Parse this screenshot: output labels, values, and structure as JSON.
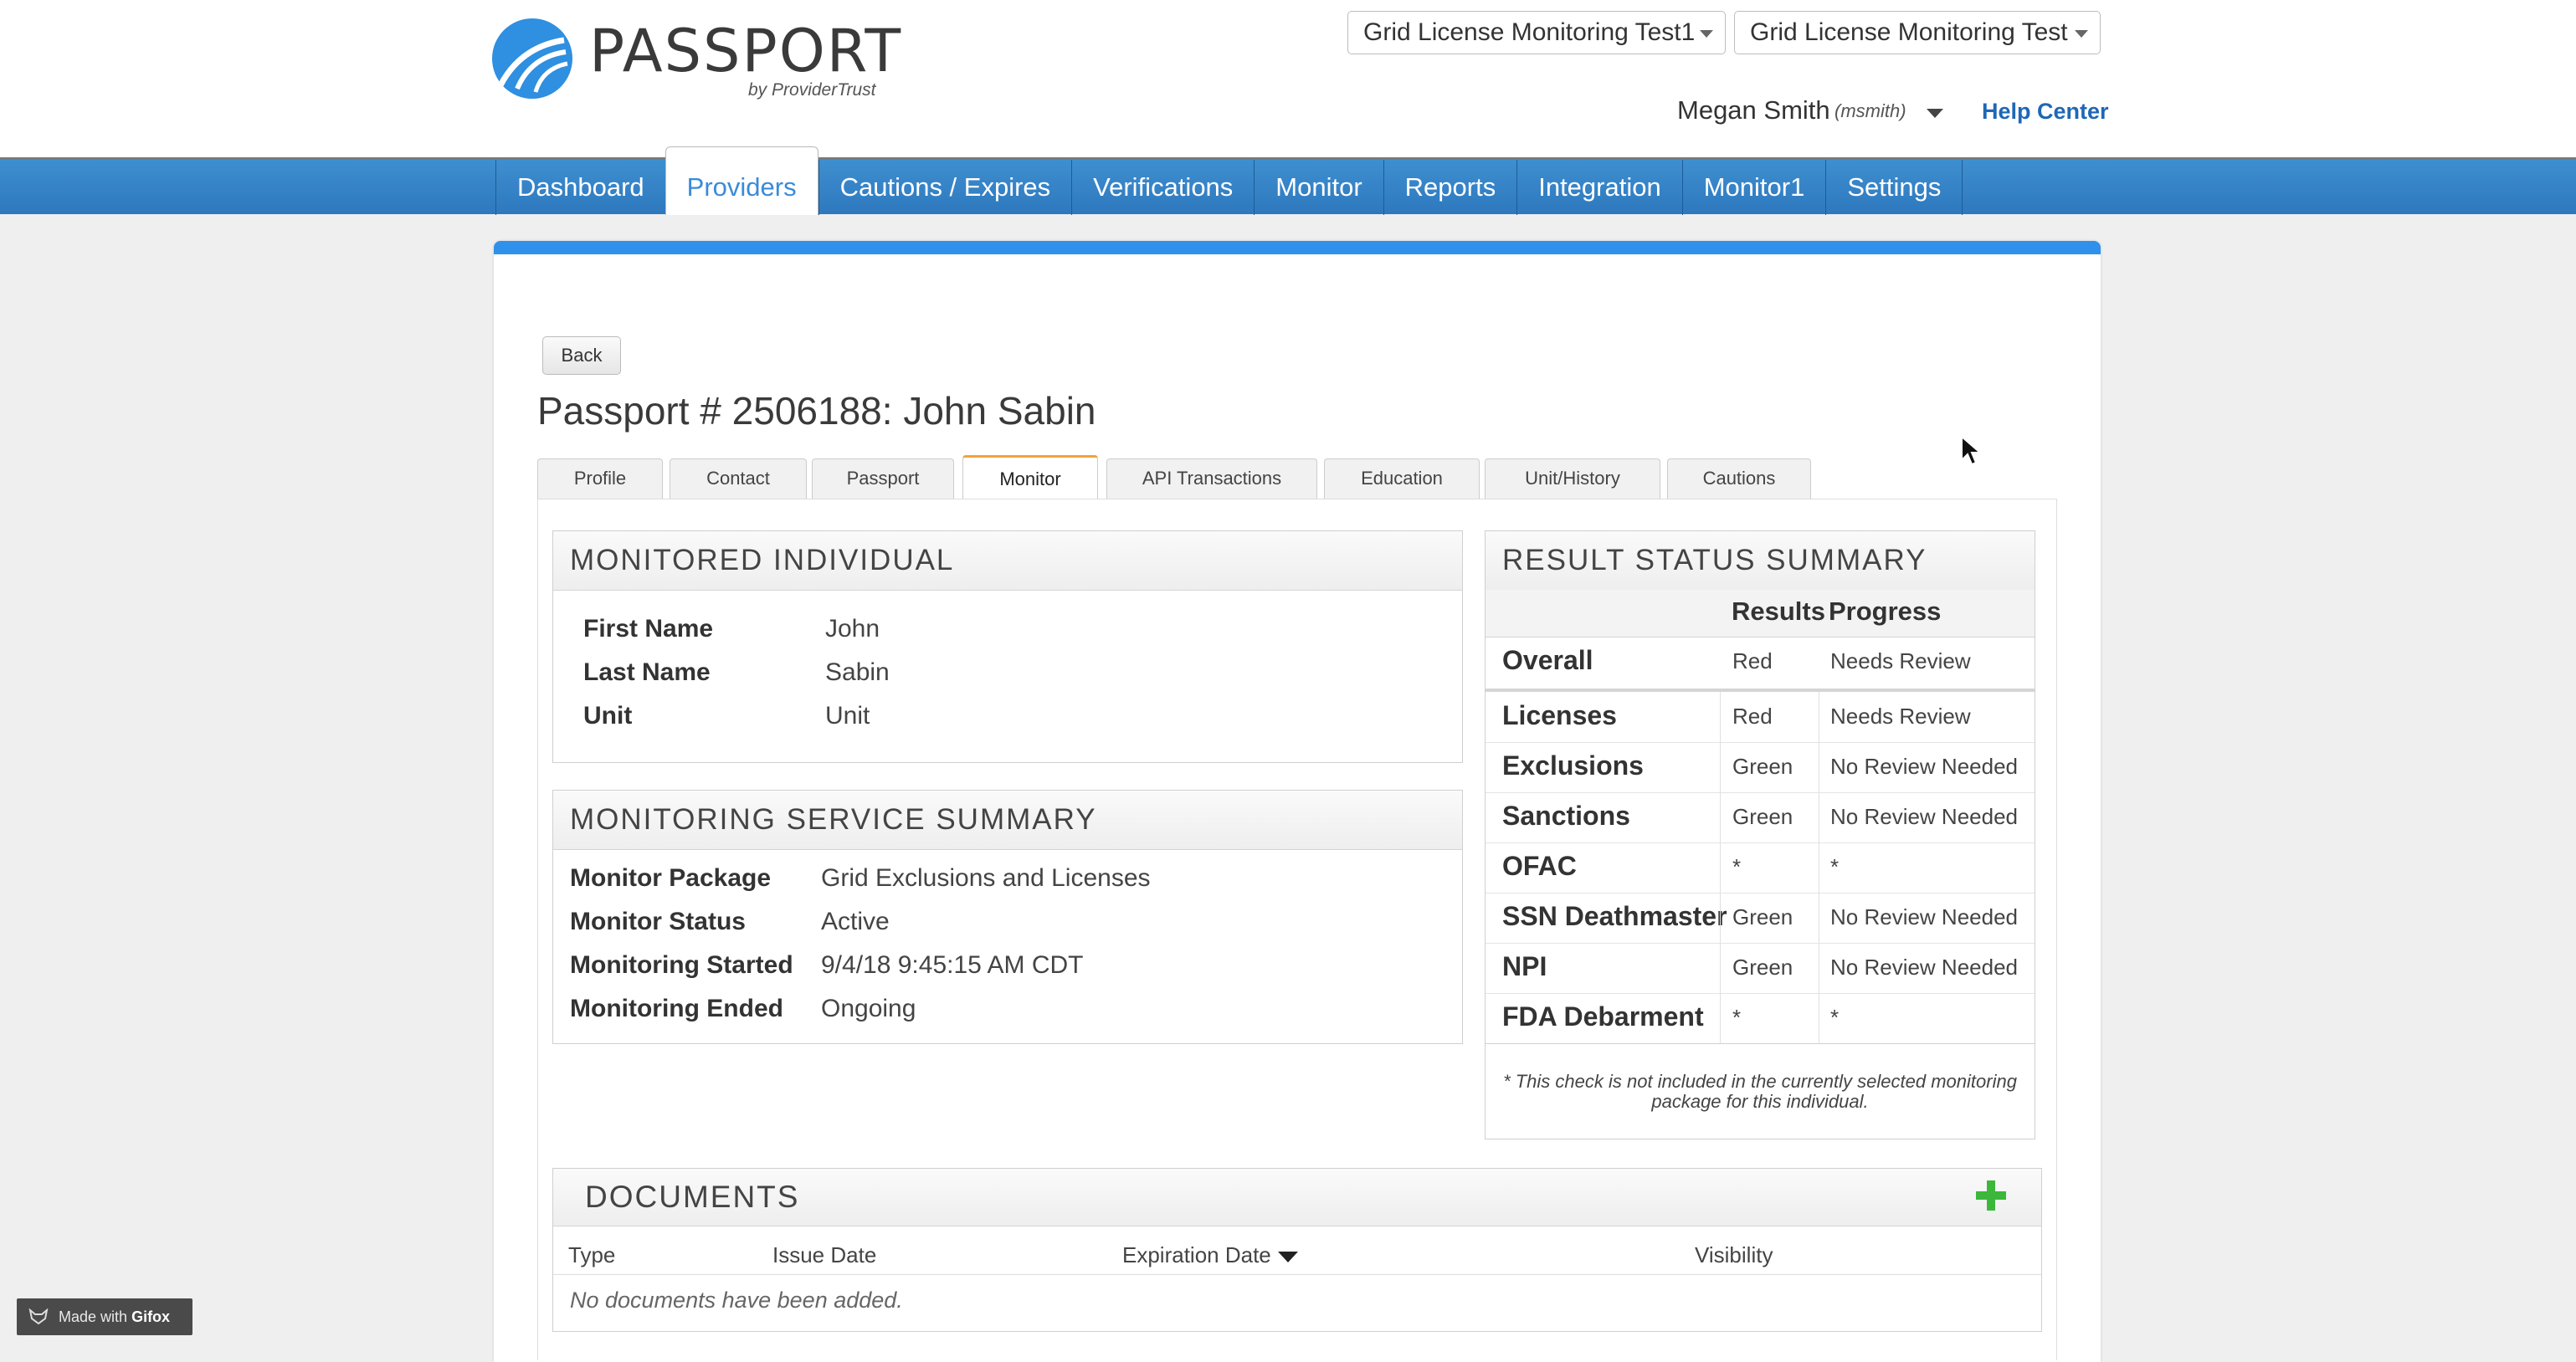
{
  "header": {
    "logo_text": "PASSPORT",
    "logo_sub": "by ProviderTrust",
    "org_select_1": "Grid License Monitoring Test1",
    "org_select_2": "Grid License Monitoring Test",
    "user_name": "Megan Smith",
    "user_login": "(msmith)",
    "help_link": "Help Center"
  },
  "nav": {
    "tabs": [
      "Dashboard",
      "Providers",
      "Cautions / Expires",
      "Verifications",
      "Monitor",
      "Reports",
      "Integration",
      "Monitor1",
      "Settings"
    ],
    "active": "Providers"
  },
  "page": {
    "back_label": "Back",
    "title": "Passport # 2506188: John Sabin",
    "sub_tabs": [
      "Profile",
      "Contact",
      "Passport",
      "Monitor",
      "API Transactions",
      "Education",
      "Unit/History",
      "Cautions"
    ],
    "active_sub_tab": "Monitor"
  },
  "monitored_individual": {
    "heading": "MONITORED INDIVIDUAL",
    "rows": [
      {
        "label": "First Name",
        "value": "John"
      },
      {
        "label": "Last Name",
        "value": "Sabin"
      },
      {
        "label": "Unit",
        "value": "Unit"
      }
    ]
  },
  "monitoring_service": {
    "heading": "MONITORING SERVICE SUMMARY",
    "rows": [
      {
        "label": "Monitor Package",
        "value": "Grid Exclusions and Licenses"
      },
      {
        "label": "Monitor Status",
        "value": "Active"
      },
      {
        "label": "Monitoring Started",
        "value": "9/4/18 9:45:15 AM CDT"
      },
      {
        "label": "Monitoring Ended",
        "value": "Ongoing"
      }
    ]
  },
  "result_status": {
    "heading": "RESULT STATUS SUMMARY",
    "col_results": "Results",
    "col_progress": "Progress",
    "overall": {
      "name": "Overall",
      "result": "Red",
      "progress": "Needs Review"
    },
    "rows": [
      {
        "name": "Licenses",
        "result": "Red",
        "progress": "Needs Review"
      },
      {
        "name": "Exclusions",
        "result": "Green",
        "progress": "No Review Needed"
      },
      {
        "name": "Sanctions",
        "result": "Green",
        "progress": "No Review Needed"
      },
      {
        "name": "OFAC",
        "result": "*",
        "progress": "*"
      },
      {
        "name": "SSN Deathmaster",
        "result": "Green",
        "progress": "No Review Needed"
      },
      {
        "name": "NPI",
        "result": "Green",
        "progress": "No Review Needed"
      },
      {
        "name": "FDA Debarment",
        "result": "*",
        "progress": "*"
      }
    ],
    "note_line1": "* This check is not included in the currently selected monitoring",
    "note_line2": "package for this individual."
  },
  "documents": {
    "heading": "DOCUMENTS",
    "columns": [
      "Type",
      "Issue Date",
      "Expiration Date",
      "Visibility"
    ],
    "empty_text": "No documents have been added."
  },
  "watermark": {
    "prefix": "Made with",
    "brand": "Gifox"
  },
  "colors": {
    "nav_blue": "#2e78be",
    "card_accent": "#2f91ec",
    "active_tab_accent": "#f2a23a",
    "add_green": "#3cb73c",
    "link_blue": "#1f67b5"
  }
}
